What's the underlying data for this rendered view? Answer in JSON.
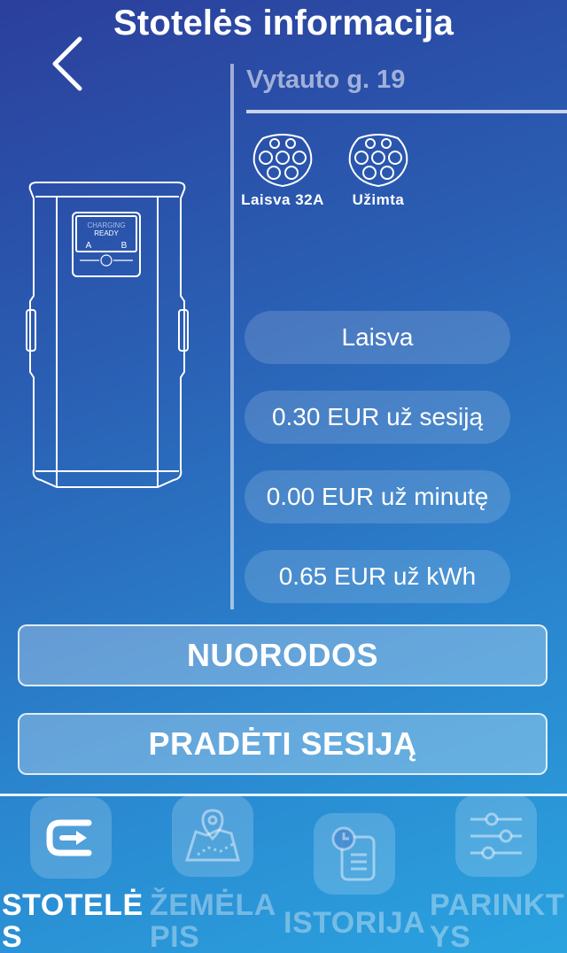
{
  "header": {
    "title": "Stotelės informacija"
  },
  "station": {
    "address": "Vytauto g. 19"
  },
  "connectors": [
    {
      "label": "Laisva 32A"
    },
    {
      "label": "Užimta"
    }
  ],
  "charger_display": {
    "line1": "CHARGING",
    "line2": "READY",
    "left": "A",
    "right": "B"
  },
  "info": {
    "status": "Laisva",
    "session_price": "0.30 EUR už sesiją",
    "minute_price": "0.00 EUR už minutę",
    "kwh_price": "0.65 EUR už kWh"
  },
  "buttons": {
    "directions": "NUORODOS",
    "start_session": "PRADĖTI SESIJĄ"
  },
  "tabs": [
    {
      "label": "STOTELĖS",
      "icon": "charger-icon",
      "active": true
    },
    {
      "label": "ŽEMĖLAPIS",
      "icon": "map-icon",
      "active": false
    },
    {
      "label": "ISTORIJA",
      "icon": "history-icon",
      "active": false
    },
    {
      "label": "PARINKTYS",
      "icon": "settings-sliders-icon",
      "active": false
    }
  ],
  "colors": {
    "active_tab": "#ffffff",
    "inactive_tab": "rgba(255,255,255,0.35)"
  }
}
